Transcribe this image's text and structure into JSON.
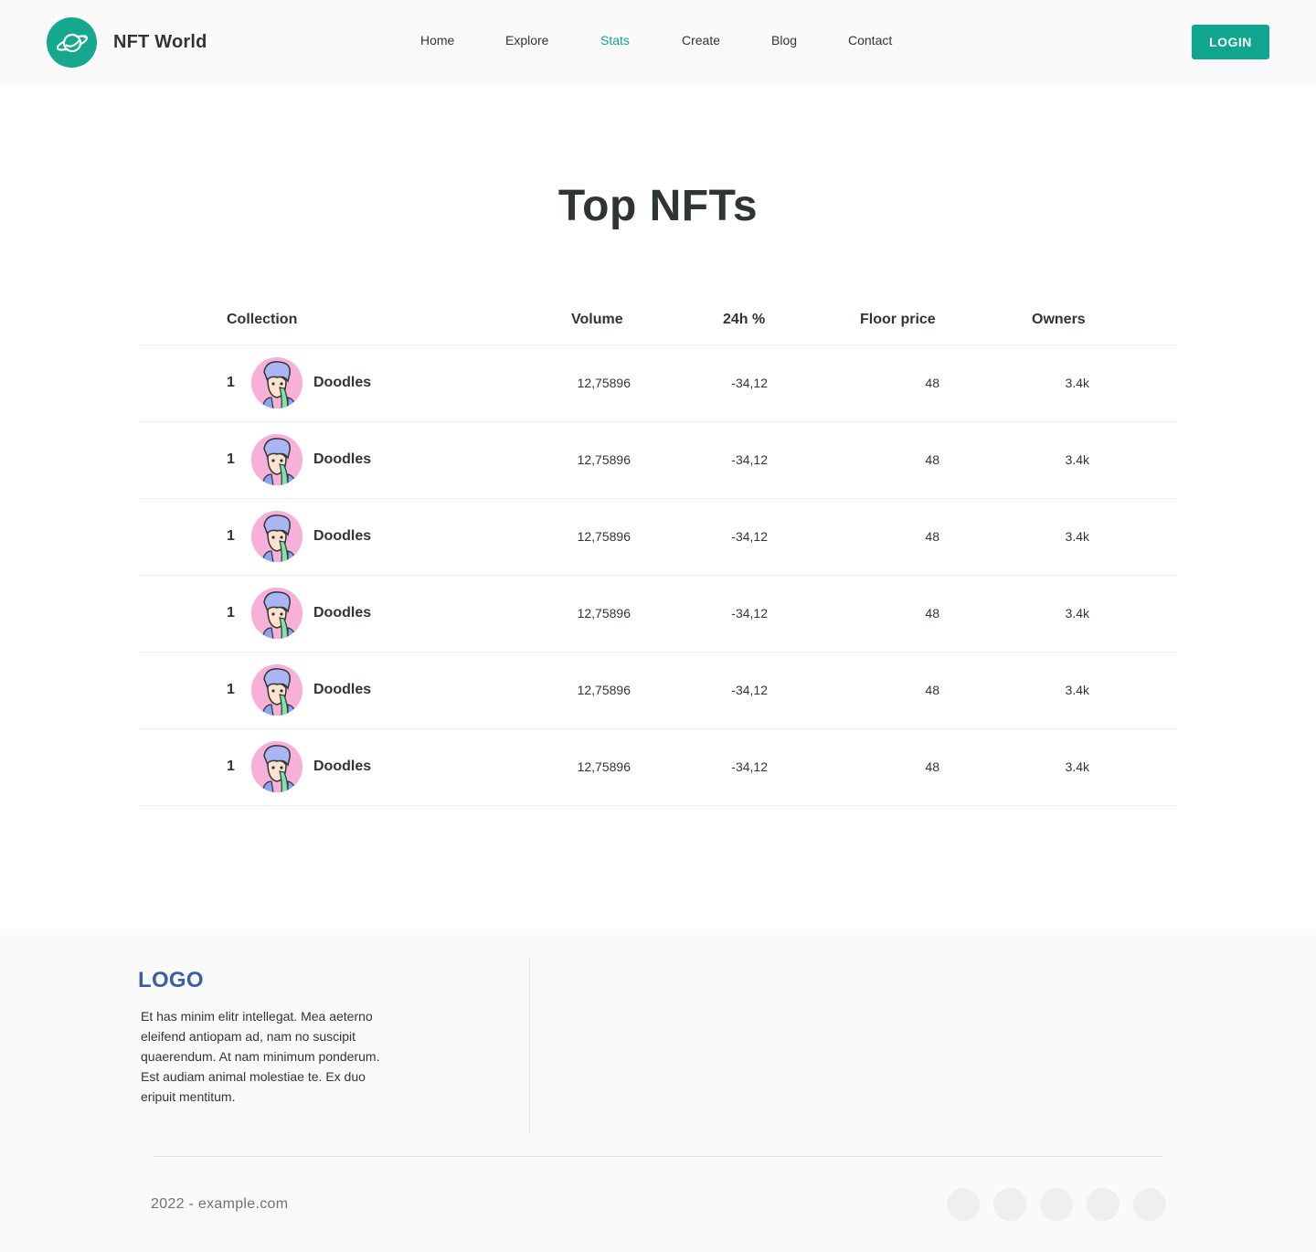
{
  "header": {
    "brand_name": "NFT World",
    "brand_icon": "planet-icon",
    "nav": [
      {
        "label": "Home",
        "active": false
      },
      {
        "label": "Explore",
        "active": false
      },
      {
        "label": "Stats",
        "active": true
      },
      {
        "label": "Create",
        "active": false
      },
      {
        "label": "Blog",
        "active": false
      },
      {
        "label": "Contact",
        "active": false
      }
    ],
    "login_label": "LOGIN"
  },
  "main": {
    "title": "Top NFTs",
    "table": {
      "headers": {
        "collection": "Collection",
        "volume": "Volume",
        "change": "24h %",
        "floor": "Floor price",
        "owners": "Owners"
      },
      "rows": [
        {
          "rank": "1",
          "name": "Doodles",
          "volume": "12,75896",
          "change": "-34,12",
          "floor": "48",
          "owners": "3.4k"
        },
        {
          "rank": "1",
          "name": "Doodles",
          "volume": "12,75896",
          "change": "-34,12",
          "floor": "48",
          "owners": "3.4k"
        },
        {
          "rank": "1",
          "name": "Doodles",
          "volume": "12,75896",
          "change": "-34,12",
          "floor": "48",
          "owners": "3.4k"
        },
        {
          "rank": "1",
          "name": "Doodles",
          "volume": "12,75896",
          "change": "-34,12",
          "floor": "48",
          "owners": "3.4k"
        },
        {
          "rank": "1",
          "name": "Doodles",
          "volume": "12,75896",
          "change": "-34,12",
          "floor": "48",
          "owners": "3.4k"
        },
        {
          "rank": "1",
          "name": "Doodles",
          "volume": "12,75896",
          "change": "-34,12",
          "floor": "48",
          "owners": "3.4k"
        }
      ]
    }
  },
  "footer": {
    "logo": "LOGO",
    "description": "Et has minim elitr intellegat. Mea aeterno eleifend antiopam ad, nam no suscipit quaerendum. At nam minimum ponderum. Est audiam animal molestiae te. Ex duo eripuit mentitum.",
    "copyright": "2022 - example.com",
    "social_icons": [
      "social-icon-1",
      "social-icon-2",
      "social-icon-3",
      "social-icon-4",
      "social-icon-5"
    ]
  },
  "colors": {
    "accent": "#10a68e",
    "active_nav": "#16a68c",
    "footer_logo": "#3a5fa5",
    "avatar_bg": "#f7b1d8"
  }
}
